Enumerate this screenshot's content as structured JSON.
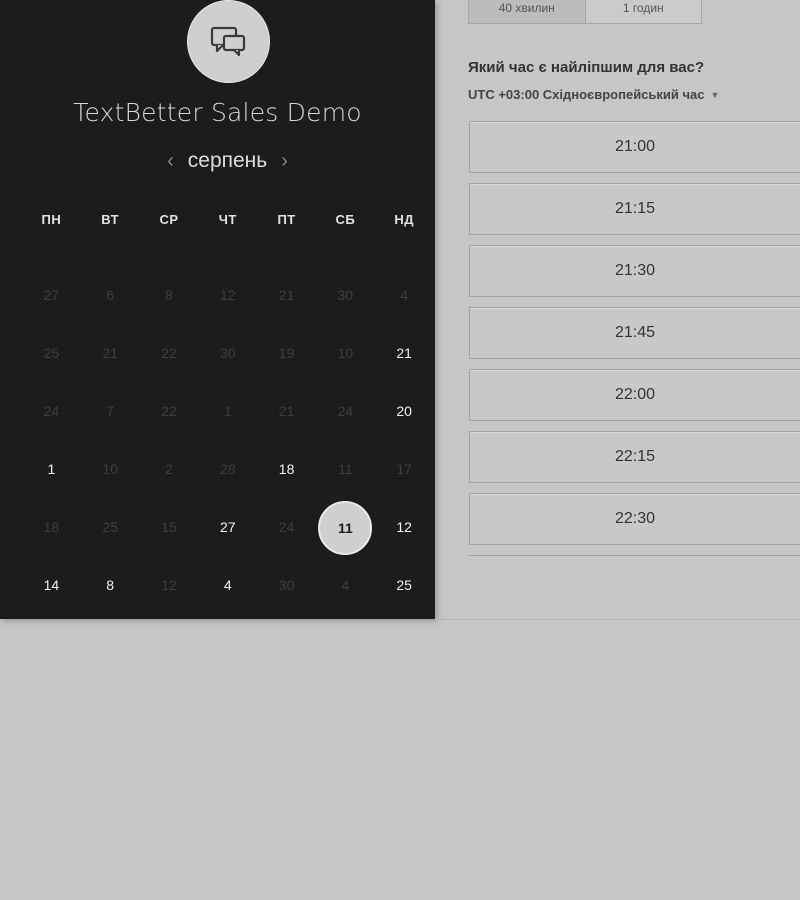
{
  "header": {
    "title": "TextBetter Sales Demo",
    "avatar_icon": "chat-bubbles-icon"
  },
  "calendar": {
    "month": "серпень",
    "prev_icon": "‹",
    "next_icon": "›",
    "weekdays": [
      "ПН",
      "ВТ",
      "СР",
      "ЧТ",
      "ПТ",
      "СБ",
      "НД"
    ],
    "weeks": [
      [
        {
          "d": "27",
          "s": "muted"
        },
        {
          "d": "6",
          "s": "muted"
        },
        {
          "d": "8",
          "s": "muted"
        },
        {
          "d": "12",
          "s": "muted"
        },
        {
          "d": "21",
          "s": "muted"
        },
        {
          "d": "30",
          "s": "muted"
        },
        {
          "d": "4",
          "s": "muted"
        }
      ],
      [
        {
          "d": "25",
          "s": "muted"
        },
        {
          "d": "21",
          "s": "muted"
        },
        {
          "d": "22",
          "s": "muted"
        },
        {
          "d": "30",
          "s": "muted"
        },
        {
          "d": "19",
          "s": "muted"
        },
        {
          "d": "10",
          "s": "muted"
        },
        {
          "d": "21",
          "s": "avail"
        }
      ],
      [
        {
          "d": "24",
          "s": "muted"
        },
        {
          "d": "7",
          "s": "muted"
        },
        {
          "d": "22",
          "s": "muted"
        },
        {
          "d": "1",
          "s": "muted"
        },
        {
          "d": "21",
          "s": "muted"
        },
        {
          "d": "24",
          "s": "muted"
        },
        {
          "d": "20",
          "s": "avail"
        }
      ],
      [
        {
          "d": "1",
          "s": "avail"
        },
        {
          "d": "10",
          "s": "muted"
        },
        {
          "d": "2",
          "s": "muted"
        },
        {
          "d": "28",
          "s": "muted"
        },
        {
          "d": "18",
          "s": "avail"
        },
        {
          "d": "11",
          "s": "muted"
        },
        {
          "d": "17",
          "s": "muted"
        }
      ],
      [
        {
          "d": "18",
          "s": "muted"
        },
        {
          "d": "25",
          "s": "muted"
        },
        {
          "d": "15",
          "s": "muted"
        },
        {
          "d": "27",
          "s": "avail"
        },
        {
          "d": "24",
          "s": "muted"
        },
        {
          "d": "11",
          "s": "selected"
        },
        {
          "d": "12",
          "s": "avail"
        }
      ],
      [
        {
          "d": "14",
          "s": "avail"
        },
        {
          "d": "8",
          "s": "avail"
        },
        {
          "d": "12",
          "s": "muted"
        },
        {
          "d": "4",
          "s": "avail"
        },
        {
          "d": "30",
          "s": "muted"
        },
        {
          "d": "4",
          "s": "muted"
        },
        {
          "d": "25",
          "s": "avail"
        }
      ]
    ]
  },
  "durations": {
    "option_1": "40 хвилин",
    "option_2": "1 годин"
  },
  "schedule": {
    "question": "Який час є найліпшим для вас?",
    "timezone": "UTC +03:00 Східноєвропейський час",
    "slots": [
      "21:00",
      "21:15",
      "21:30",
      "21:45",
      "22:00",
      "22:15",
      "22:30"
    ]
  }
}
